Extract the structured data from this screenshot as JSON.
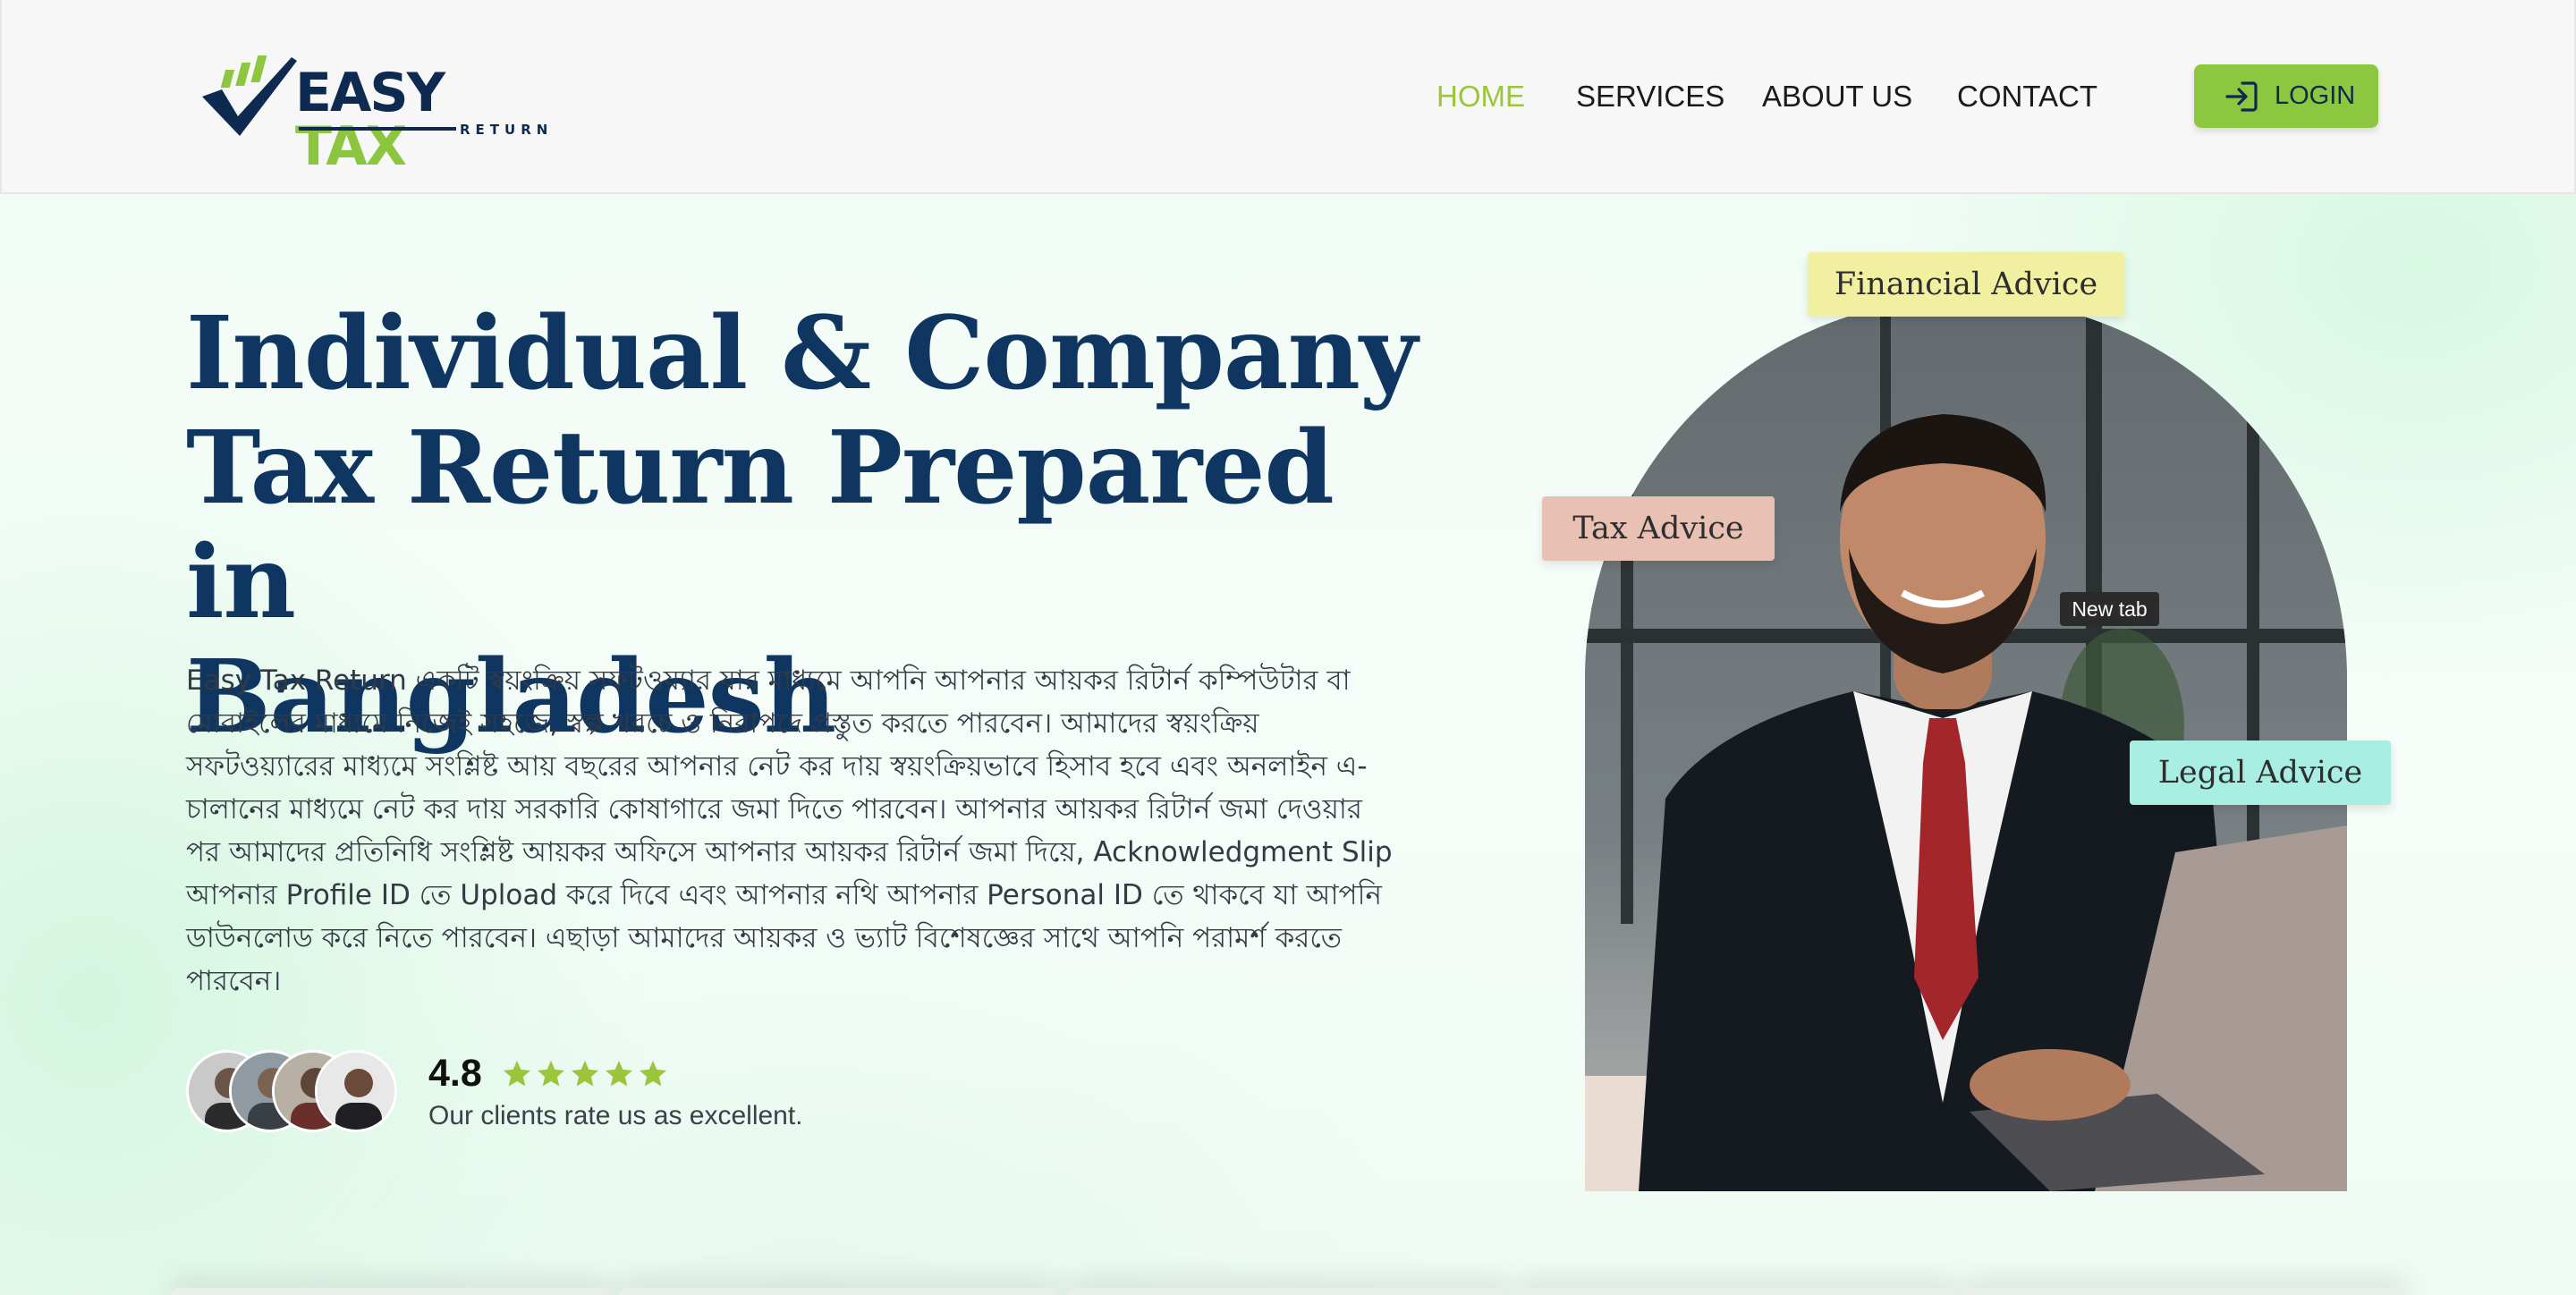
{
  "header": {
    "logo": {
      "main": "EASY",
      "accent": "TAX",
      "sub": "RETURN"
    },
    "nav": [
      {
        "label": "HOME",
        "active": true
      },
      {
        "label": "SERVICES",
        "active": false
      },
      {
        "label": "ABOUT US",
        "active": false
      },
      {
        "label": "CONTACT",
        "active": false
      }
    ],
    "login_label": "LOGIN",
    "login_icon": "sign-in-icon"
  },
  "hero": {
    "title_lines": [
      "Individual & Company",
      "Tax Return Prepared in",
      "Bangladesh"
    ],
    "description": "Easy Tax Return একটি স্বয়ংক্রিয় সফটওয়্যার যার মাধ্যমে আপনি আপনার আয়কর রিটার্ন কম্পিউটার বা মোবাইলের মাধ্যমে নিজেই সহজে, স্বল্প খরচে ও নিরাপদে প্রস্তুত করতে পারবেন। আমাদের স্বয়ংক্রিয় সফটওয়্যারের মাধ্যমে সংশ্লিষ্ট আয় বছরের আপনার নেট কর দায় স্বয়ংক্রিয়ভাবে হিসাব হবে এবং অনলাইন এ-চালানের মাধ্যমে নেট কর দায় সরকারি কোষাগারে জমা দিতে পারবেন। আপনার আয়কর রিটার্ন জমা দেওয়ার পর আমাদের প্রতিনিধি সংশ্লিষ্ট আয়কর অফিসে আপনার আয়কর রিটার্ন জমা দিয়ে, Acknowledgment Slip আপনার Profile ID তে Upload করে দিবে এবং আপনার নথি আপনার Personal ID তে থাকবে যা আপনি ডাউনলোড করে নিতে পারবেন। এছাড়া আমাদের আয়কর ও ভ্যাট বিশেষজ্ঞের সাথে আপনি পরামর্শ করতে পারবেন।",
    "rating": {
      "value": "4.8",
      "stars": 5,
      "caption": "Our clients rate us as excellent."
    },
    "badges": {
      "financial": "Financial Advice",
      "tax": "Tax Advice",
      "legal": "Legal Advice"
    },
    "tooltip": "New tab"
  },
  "colors": {
    "brand_navy": "#0f3561",
    "brand_green": "#8dc63f",
    "nav_active": "#9bc53d"
  }
}
